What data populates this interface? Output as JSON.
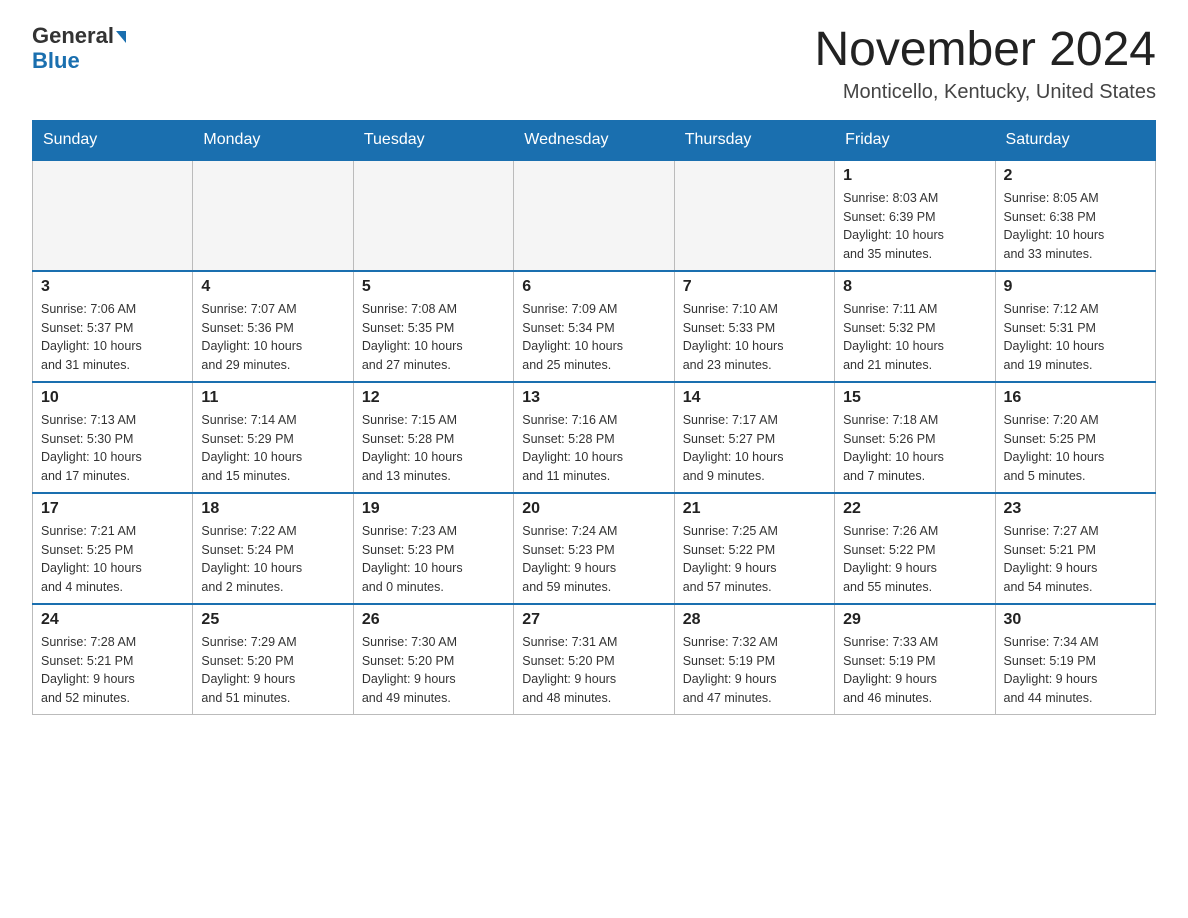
{
  "header": {
    "logo_line1": "General",
    "logo_line2": "Blue",
    "title": "November 2024",
    "subtitle": "Monticello, Kentucky, United States"
  },
  "weekdays": [
    "Sunday",
    "Monday",
    "Tuesday",
    "Wednesday",
    "Thursday",
    "Friday",
    "Saturday"
  ],
  "weeks": [
    [
      {
        "day": "",
        "info": ""
      },
      {
        "day": "",
        "info": ""
      },
      {
        "day": "",
        "info": ""
      },
      {
        "day": "",
        "info": ""
      },
      {
        "day": "",
        "info": ""
      },
      {
        "day": "1",
        "info": "Sunrise: 8:03 AM\nSunset: 6:39 PM\nDaylight: 10 hours\nand 35 minutes."
      },
      {
        "day": "2",
        "info": "Sunrise: 8:05 AM\nSunset: 6:38 PM\nDaylight: 10 hours\nand 33 minutes."
      }
    ],
    [
      {
        "day": "3",
        "info": "Sunrise: 7:06 AM\nSunset: 5:37 PM\nDaylight: 10 hours\nand 31 minutes."
      },
      {
        "day": "4",
        "info": "Sunrise: 7:07 AM\nSunset: 5:36 PM\nDaylight: 10 hours\nand 29 minutes."
      },
      {
        "day": "5",
        "info": "Sunrise: 7:08 AM\nSunset: 5:35 PM\nDaylight: 10 hours\nand 27 minutes."
      },
      {
        "day": "6",
        "info": "Sunrise: 7:09 AM\nSunset: 5:34 PM\nDaylight: 10 hours\nand 25 minutes."
      },
      {
        "day": "7",
        "info": "Sunrise: 7:10 AM\nSunset: 5:33 PM\nDaylight: 10 hours\nand 23 minutes."
      },
      {
        "day": "8",
        "info": "Sunrise: 7:11 AM\nSunset: 5:32 PM\nDaylight: 10 hours\nand 21 minutes."
      },
      {
        "day": "9",
        "info": "Sunrise: 7:12 AM\nSunset: 5:31 PM\nDaylight: 10 hours\nand 19 minutes."
      }
    ],
    [
      {
        "day": "10",
        "info": "Sunrise: 7:13 AM\nSunset: 5:30 PM\nDaylight: 10 hours\nand 17 minutes."
      },
      {
        "day": "11",
        "info": "Sunrise: 7:14 AM\nSunset: 5:29 PM\nDaylight: 10 hours\nand 15 minutes."
      },
      {
        "day": "12",
        "info": "Sunrise: 7:15 AM\nSunset: 5:28 PM\nDaylight: 10 hours\nand 13 minutes."
      },
      {
        "day": "13",
        "info": "Sunrise: 7:16 AM\nSunset: 5:28 PM\nDaylight: 10 hours\nand 11 minutes."
      },
      {
        "day": "14",
        "info": "Sunrise: 7:17 AM\nSunset: 5:27 PM\nDaylight: 10 hours\nand 9 minutes."
      },
      {
        "day": "15",
        "info": "Sunrise: 7:18 AM\nSunset: 5:26 PM\nDaylight: 10 hours\nand 7 minutes."
      },
      {
        "day": "16",
        "info": "Sunrise: 7:20 AM\nSunset: 5:25 PM\nDaylight: 10 hours\nand 5 minutes."
      }
    ],
    [
      {
        "day": "17",
        "info": "Sunrise: 7:21 AM\nSunset: 5:25 PM\nDaylight: 10 hours\nand 4 minutes."
      },
      {
        "day": "18",
        "info": "Sunrise: 7:22 AM\nSunset: 5:24 PM\nDaylight: 10 hours\nand 2 minutes."
      },
      {
        "day": "19",
        "info": "Sunrise: 7:23 AM\nSunset: 5:23 PM\nDaylight: 10 hours\nand 0 minutes."
      },
      {
        "day": "20",
        "info": "Sunrise: 7:24 AM\nSunset: 5:23 PM\nDaylight: 9 hours\nand 59 minutes."
      },
      {
        "day": "21",
        "info": "Sunrise: 7:25 AM\nSunset: 5:22 PM\nDaylight: 9 hours\nand 57 minutes."
      },
      {
        "day": "22",
        "info": "Sunrise: 7:26 AM\nSunset: 5:22 PM\nDaylight: 9 hours\nand 55 minutes."
      },
      {
        "day": "23",
        "info": "Sunrise: 7:27 AM\nSunset: 5:21 PM\nDaylight: 9 hours\nand 54 minutes."
      }
    ],
    [
      {
        "day": "24",
        "info": "Sunrise: 7:28 AM\nSunset: 5:21 PM\nDaylight: 9 hours\nand 52 minutes."
      },
      {
        "day": "25",
        "info": "Sunrise: 7:29 AM\nSunset: 5:20 PM\nDaylight: 9 hours\nand 51 minutes."
      },
      {
        "day": "26",
        "info": "Sunrise: 7:30 AM\nSunset: 5:20 PM\nDaylight: 9 hours\nand 49 minutes."
      },
      {
        "day": "27",
        "info": "Sunrise: 7:31 AM\nSunset: 5:20 PM\nDaylight: 9 hours\nand 48 minutes."
      },
      {
        "day": "28",
        "info": "Sunrise: 7:32 AM\nSunset: 5:19 PM\nDaylight: 9 hours\nand 47 minutes."
      },
      {
        "day": "29",
        "info": "Sunrise: 7:33 AM\nSunset: 5:19 PM\nDaylight: 9 hours\nand 46 minutes."
      },
      {
        "day": "30",
        "info": "Sunrise: 7:34 AM\nSunset: 5:19 PM\nDaylight: 9 hours\nand 44 minutes."
      }
    ]
  ]
}
